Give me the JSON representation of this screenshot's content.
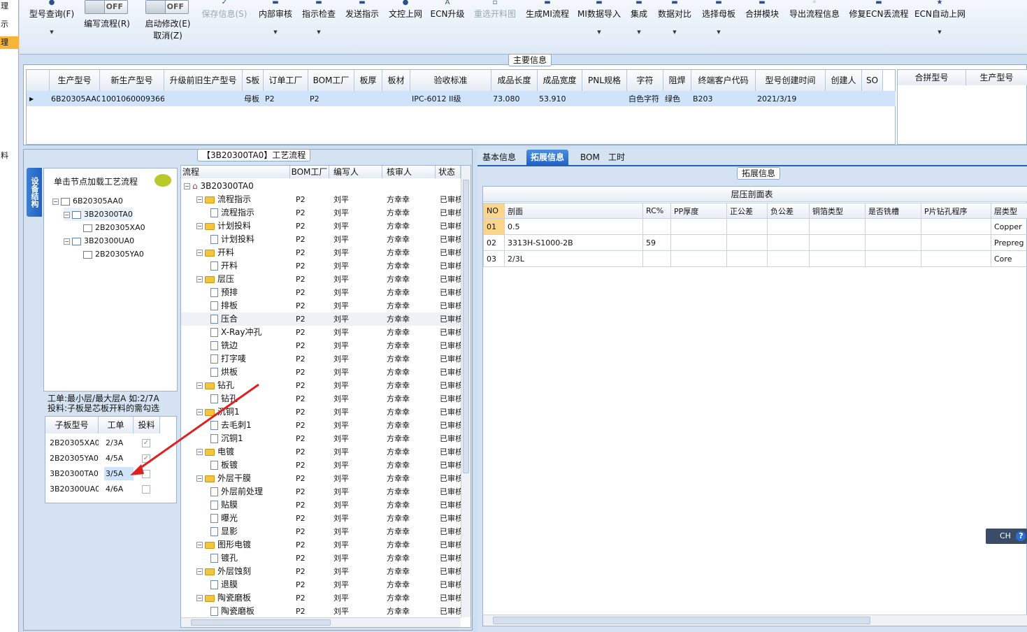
{
  "left_strip": [
    "理",
    "示",
    "理",
    "料"
  ],
  "toolbar": {
    "model_query": "型号查询(F)",
    "edit_flow": "编写流程(R)",
    "edit_flow_toggle": "OFF",
    "start_modify": "启动修改(E)",
    "start_modify_toggle": "OFF",
    "cancel": "取消(Z)",
    "save_info": "保存信息(S)",
    "internal_review": "内部审核",
    "instruction_check": "指示检查",
    "send_instruction": "发送指示",
    "doc_online": "文控上网",
    "ecn_upgrade": "ECN升级",
    "reselect_chart": "重选开料图",
    "gen_mi_flow": "生成MI流程",
    "mi_import": "MI数据导入",
    "integrate": "集成",
    "data_compare": "数据对比",
    "select_master": "选择母板",
    "merge_module": "合拼模块",
    "export_flow": "导出流程信息",
    "fix_ecn": "修复ECN丢流程",
    "ecn_auto_online": "ECN自动上网"
  },
  "main_info": {
    "title": "主要信息",
    "columns": [
      "生产型号",
      "新生产型号",
      "升级前旧生产型号",
      "S板",
      "订单工厂",
      "BOM工厂",
      "板厚",
      "板材",
      "验收标准",
      "成品长度",
      "成品宽度",
      "PNL规格",
      "字符",
      "阻焊",
      "终端客户代码",
      "型号创建时间",
      "创建人",
      "SO"
    ],
    "row": [
      "6B20305AA0",
      "10010600093666",
      "",
      "母板",
      "P2",
      "P2",
      "",
      "",
      "IPC-6012 II级",
      "73.080",
      "53.910",
      "",
      "白色字符",
      "绿色",
      "B203",
      "2021/3/19",
      "",
      ""
    ],
    "right_columns": [
      "合拼型号",
      "生产型号"
    ]
  },
  "process": {
    "title": "【3B20300TA0】工艺流程",
    "vertical_tab": "设备结构",
    "hint": "单击节点加载工艺流程",
    "tree": [
      {
        "label": "6B20305AA0",
        "level": 0
      },
      {
        "label": "3B20300TA0",
        "level": 1
      },
      {
        "label": "2B20305XA0",
        "level": 2
      },
      {
        "label": "3B20300UA0",
        "level": 1
      },
      {
        "label": "2B20305YA0",
        "level": 2
      }
    ],
    "note1": "工单:最小层/最大层A 如:2/7A",
    "note2": "投料:子板是芯板开料的需勾选",
    "sub_columns": [
      "子板型号",
      "工单",
      "投料"
    ],
    "sub_rows": [
      {
        "model": "2B20305XA0",
        "order": "2/3A",
        "checked": true
      },
      {
        "model": "2B20305YA0",
        "order": "4/5A",
        "checked": true
      },
      {
        "model": "3B20300TA0",
        "order": "3/5A",
        "checked": false
      },
      {
        "model": "3B20300UA0",
        "order": "4/6A",
        "checked": false
      }
    ],
    "flow_columns": [
      "流程",
      "BOM工厂",
      "编写人",
      "核审人",
      "状态"
    ],
    "flow_root": "3B20300TA0",
    "flow_factory": "P2",
    "flow_writer": "刘平",
    "flow_reviewer": "方幸幸",
    "flow_status": "已审核",
    "flow_items": [
      {
        "label": "流程指示",
        "folder": true
      },
      {
        "label": "流程指示",
        "folder": false
      },
      {
        "label": "计划投料",
        "folder": true
      },
      {
        "label": "计划投料",
        "folder": false
      },
      {
        "label": "开料",
        "folder": true
      },
      {
        "label": "开料",
        "folder": false
      },
      {
        "label": "层压",
        "folder": true
      },
      {
        "label": "预排",
        "folder": false
      },
      {
        "label": "排板",
        "folder": false
      },
      {
        "label": "压合",
        "folder": false
      },
      {
        "label": "X-Ray冲孔",
        "folder": false
      },
      {
        "label": "铣边",
        "folder": false
      },
      {
        "label": "打字唛",
        "folder": false
      },
      {
        "label": "烘板",
        "folder": false
      },
      {
        "label": "钻孔",
        "folder": true
      },
      {
        "label": "钻孔",
        "folder": false
      },
      {
        "label": "沉铜1",
        "folder": true
      },
      {
        "label": "去毛刺1",
        "folder": false
      },
      {
        "label": "沉铜1",
        "folder": false
      },
      {
        "label": "电镀",
        "folder": true
      },
      {
        "label": "板镀",
        "folder": false
      },
      {
        "label": "外层干膜",
        "folder": true
      },
      {
        "label": "外层前处理",
        "folder": false
      },
      {
        "label": "贴膜",
        "folder": false
      },
      {
        "label": "曝光",
        "folder": false
      },
      {
        "label": "显影",
        "folder": false
      },
      {
        "label": "图形电镀",
        "folder": true
      },
      {
        "label": "镀孔",
        "folder": false
      },
      {
        "label": "外层蚀刻",
        "folder": true
      },
      {
        "label": "退膜",
        "folder": false
      },
      {
        "label": "陶瓷磨板",
        "folder": true
      },
      {
        "label": "陶瓷磨板",
        "folder": false
      }
    ]
  },
  "ext": {
    "tabs": [
      "基本信息",
      "拓展信息",
      "BOM",
      "工时"
    ],
    "active_tab": "拓展信息",
    "group_title": "拓展信息",
    "table_title": "层压剖面表",
    "columns": [
      "NO",
      "剖面",
      "RC%",
      "PP厚度",
      "正公差",
      "负公差",
      "铜箔类型",
      "是否铣槽",
      "P片钻孔程序",
      "层类型"
    ],
    "rows": [
      [
        "01",
        "0.5",
        "",
        "",
        "",
        "",
        "",
        "",
        "",
        "Copper"
      ],
      [
        "02",
        "3313H-S1000-2B",
        "59",
        "",
        "",
        "",
        "",
        "",
        "",
        "Prepreg"
      ],
      [
        "03",
        "2/3L",
        "",
        "",
        "",
        "",
        "",
        "",
        "",
        "Core"
      ]
    ]
  },
  "ime": {
    "label": "CH",
    "help": "?"
  },
  "colors": {
    "accent": "#1f62c3",
    "selected_row": "#cfe4fa",
    "arrow": "#e02020"
  }
}
